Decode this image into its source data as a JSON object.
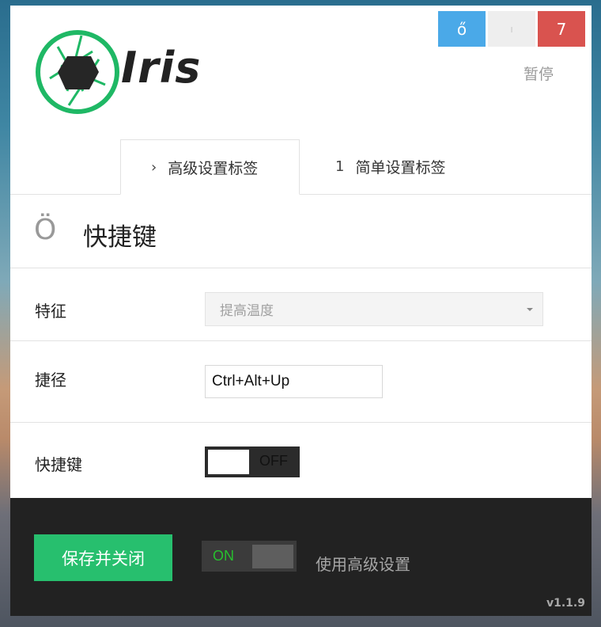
{
  "app": {
    "name": "Iris"
  },
  "window_controls": {
    "btn1_glyph": "ő",
    "btn2_glyph": "ı",
    "btn3_glyph": "7"
  },
  "header": {
    "pause_link": "暂停"
  },
  "tabs": [
    {
      "icon": "›",
      "label": "高级设置标签",
      "active": true
    },
    {
      "icon": "1",
      "label": "简单设置标签",
      "active": false
    }
  ],
  "section": {
    "icon_glyph": "Ö",
    "title": "快捷键"
  },
  "form": {
    "feature": {
      "label": "特征",
      "placeholder": "提高温度"
    },
    "shortcut": {
      "label": "捷径",
      "value": "Ctrl+Alt+Up"
    },
    "hotkeys": {
      "label": "快捷键",
      "toggle_text": "OFF"
    }
  },
  "footer": {
    "save_button": "保存并关闭",
    "advanced_toggle_text": "ON",
    "advanced_label": "使用高级设置",
    "version": "v1.1.9"
  },
  "colors": {
    "accent_green": "#27bf6e",
    "close_red": "#d9534f",
    "minimize_blue": "#4aa9e8",
    "footer_bg": "#222222"
  }
}
